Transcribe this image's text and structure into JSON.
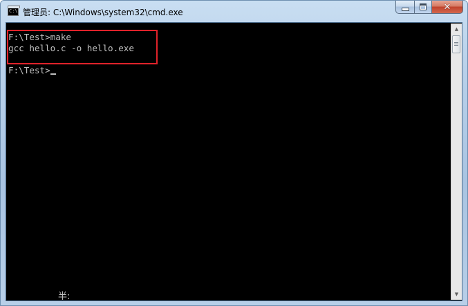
{
  "window": {
    "title": "管理员: C:\\Windows\\system32\\cmd.exe",
    "icon": "cmd-icon",
    "icon_label": "C:\\"
  },
  "caption_buttons": {
    "minimize_icon": "minimize-icon",
    "maximize_icon": "maximize-icon",
    "close_icon": "close-icon",
    "close_glyph": "✕"
  },
  "console": {
    "lines": [
      "F:\\Test>make",
      "gcc hello.c -o hello.exe",
      "",
      "F:\\Test>"
    ],
    "text_color": "#c0c0c0",
    "background": "#000000"
  },
  "highlight": {
    "color": "#e0222a"
  },
  "ime_status": "半:",
  "scrollbar": {
    "up_glyph": "▲",
    "down_glyph": "▼"
  }
}
